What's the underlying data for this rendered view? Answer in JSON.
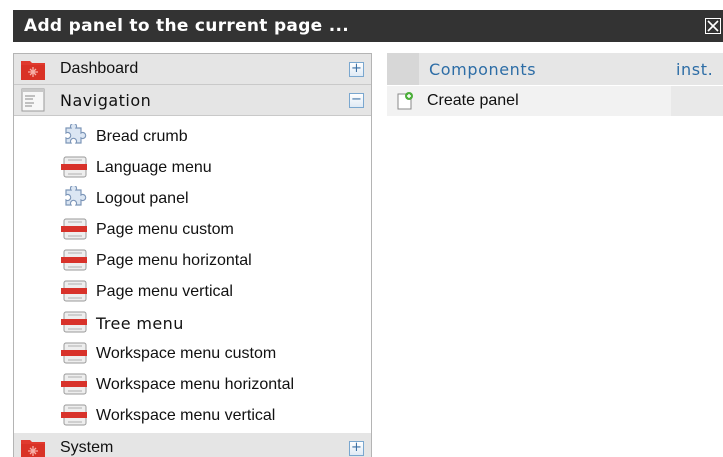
{
  "dialog": {
    "title": "Add panel to the current page ..."
  },
  "categories": [
    {
      "label": "Dashboard",
      "toggle": "+"
    },
    {
      "label": "Navigation",
      "toggle": "−"
    },
    {
      "label": "System",
      "toggle": "+"
    }
  ],
  "navigation_items": [
    {
      "label": "Bread crumb",
      "icon": "puzzle-icon"
    },
    {
      "label": "Language menu",
      "icon": "menu-widget-icon"
    },
    {
      "label": "Logout panel",
      "icon": "puzzle-icon"
    },
    {
      "label": "Page menu custom",
      "icon": "menu-widget-icon"
    },
    {
      "label": "Page menu horizontal",
      "icon": "menu-widget-icon"
    },
    {
      "label": "Page menu vertical",
      "icon": "menu-widget-icon"
    },
    {
      "label": "Tree menu",
      "icon": "menu-widget-icon"
    },
    {
      "label": "Workspace menu custom",
      "icon": "menu-widget-icon"
    },
    {
      "label": "Workspace menu horizontal",
      "icon": "menu-widget-icon"
    },
    {
      "label": "Workspace menu vertical",
      "icon": "menu-widget-icon"
    }
  ],
  "components_table": {
    "headers": [
      "Components",
      "inst."
    ],
    "rows": [
      {
        "label": "Create panel",
        "inst": ""
      }
    ]
  },
  "colors": {
    "titlebar": "#333333",
    "header_text": "#2d6da6",
    "folder_red": "#e03a2e"
  }
}
